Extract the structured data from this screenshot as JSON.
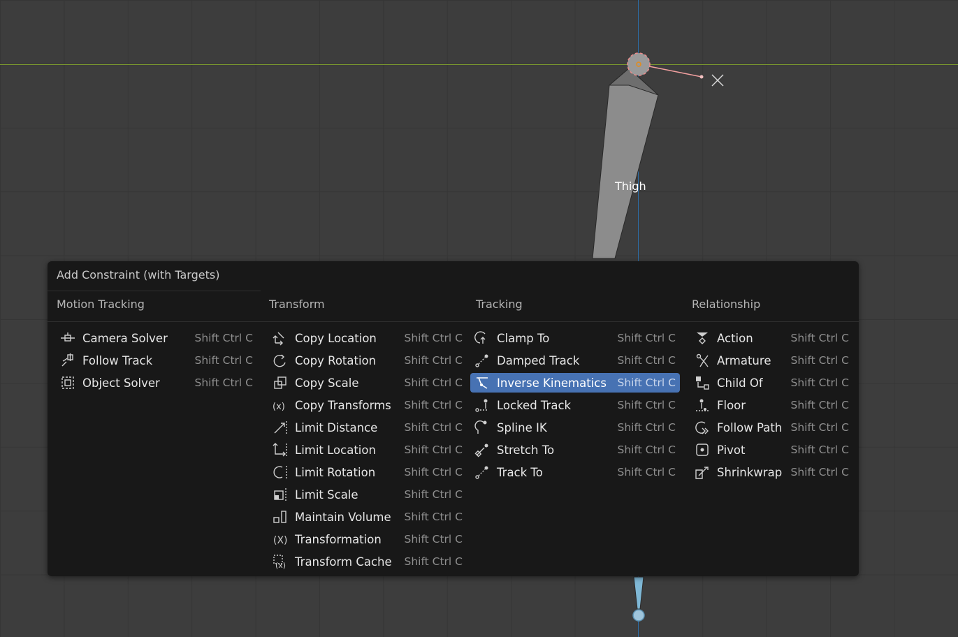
{
  "viewport": {
    "bone_label": "Thigh",
    "axis_marker": "X"
  },
  "menu": {
    "title": "Add Constraint (with Targets)",
    "columns": [
      {
        "heading": "Motion Tracking",
        "items": [
          {
            "label": "Camera Solver",
            "shortcut": "Shift Ctrl C",
            "icon": "camera-solver-icon"
          },
          {
            "label": "Follow Track",
            "shortcut": "Shift Ctrl C",
            "icon": "follow-track-icon"
          },
          {
            "label": "Object Solver",
            "shortcut": "Shift Ctrl C",
            "icon": "object-solver-icon"
          }
        ]
      },
      {
        "heading": "Transform",
        "items": [
          {
            "label": "Copy Location",
            "shortcut": "Shift Ctrl C",
            "icon": "copy-location-icon"
          },
          {
            "label": "Copy Rotation",
            "shortcut": "Shift Ctrl C",
            "icon": "copy-rotation-icon"
          },
          {
            "label": "Copy Scale",
            "shortcut": "Shift Ctrl C",
            "icon": "copy-scale-icon"
          },
          {
            "label": "Copy Transforms",
            "shortcut": "Shift Ctrl C",
            "icon": "copy-transforms-icon"
          },
          {
            "label": "Limit Distance",
            "shortcut": "Shift Ctrl C",
            "icon": "limit-distance-icon"
          },
          {
            "label": "Limit Location",
            "shortcut": "Shift Ctrl C",
            "icon": "limit-location-icon"
          },
          {
            "label": "Limit Rotation",
            "shortcut": "Shift Ctrl C",
            "icon": "limit-rotation-icon"
          },
          {
            "label": "Limit Scale",
            "shortcut": "Shift Ctrl C",
            "icon": "limit-scale-icon"
          },
          {
            "label": "Maintain Volume",
            "shortcut": "Shift Ctrl C",
            "icon": "maintain-volume-icon"
          },
          {
            "label": "Transformation",
            "shortcut": "Shift Ctrl C",
            "icon": "transformation-icon"
          },
          {
            "label": "Transform Cache",
            "shortcut": "Shift Ctrl C",
            "icon": "transform-cache-icon"
          }
        ]
      },
      {
        "heading": "Tracking",
        "items": [
          {
            "label": "Clamp To",
            "shortcut": "Shift Ctrl C",
            "icon": "clamp-to-icon"
          },
          {
            "label": "Damped Track",
            "shortcut": "Shift Ctrl C",
            "icon": "damped-track-icon"
          },
          {
            "label": "Inverse Kinematics",
            "shortcut": "Shift Ctrl C",
            "icon": "inverse-kinematics-icon",
            "active": true
          },
          {
            "label": "Locked Track",
            "shortcut": "Shift Ctrl C",
            "icon": "locked-track-icon"
          },
          {
            "label": "Spline IK",
            "shortcut": "Shift Ctrl C",
            "icon": "spline-ik-icon"
          },
          {
            "label": "Stretch To",
            "shortcut": "Shift Ctrl C",
            "icon": "stretch-to-icon"
          },
          {
            "label": "Track To",
            "shortcut": "Shift Ctrl C",
            "icon": "track-to-icon"
          }
        ]
      },
      {
        "heading": "Relationship",
        "items": [
          {
            "label": "Action",
            "shortcut": "Shift Ctrl C",
            "icon": "action-icon"
          },
          {
            "label": "Armature",
            "shortcut": "Shift Ctrl C",
            "icon": "armature-icon"
          },
          {
            "label": "Child Of",
            "shortcut": "Shift Ctrl C",
            "icon": "child-of-icon"
          },
          {
            "label": "Floor",
            "shortcut": "Shift Ctrl C",
            "icon": "floor-icon"
          },
          {
            "label": "Follow Path",
            "shortcut": "Shift Ctrl C",
            "icon": "follow-path-icon"
          },
          {
            "label": "Pivot",
            "shortcut": "Shift Ctrl C",
            "icon": "pivot-icon"
          },
          {
            "label": "Shrinkwrap",
            "shortcut": "Shift Ctrl C",
            "icon": "shrinkwrap-icon"
          }
        ]
      }
    ]
  },
  "colors": {
    "highlight": "#4772b3",
    "menu_bg": "#181818",
    "viewport_bg": "#3d3d3d",
    "x_axis": "#7b9a2e",
    "z_axis": "#2f6fa8"
  }
}
